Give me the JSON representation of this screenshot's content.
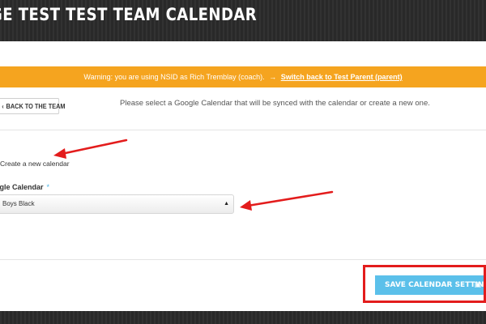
{
  "header": {
    "title": "GE TEST TEST TEAM CALENDAR"
  },
  "warning": {
    "message": "Warning: you are using NSID as Rich Tremblay (coach).",
    "switch_icon": "switch-user-icon",
    "switch_link": "Switch back to Test Parent (parent)"
  },
  "toolbar": {
    "back_label": "BACK TO THE TEAM",
    "back_icon": "chevron-left-icon"
  },
  "instruction": "Please select a Google Calendar that will be synced with the calendar or create a new one.",
  "form": {
    "create_new_label": "Create a new calendar",
    "calendar_label": "ogle Calendar",
    "required_mark": "*",
    "calendar_value": "Boys Black"
  },
  "footer": {
    "save_label": "SAVE CALENDAR SETTINGS",
    "save_icon": "floppy-disk-icon"
  },
  "colors": {
    "warning_bg": "#f5a41f",
    "save_button_bg": "#5bc0ea",
    "annotation_red": "#e31c1c",
    "header_bg": "#2b2b2b"
  }
}
